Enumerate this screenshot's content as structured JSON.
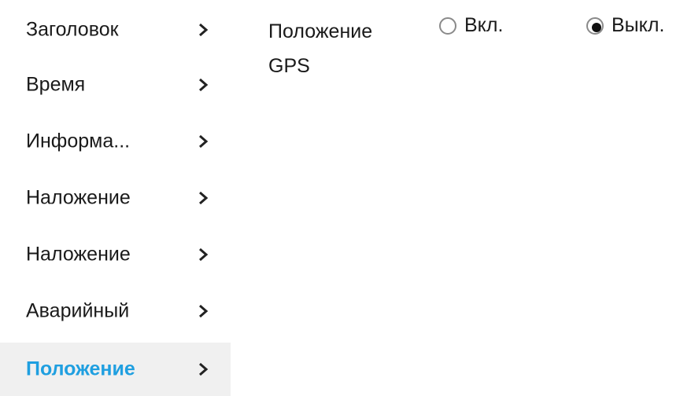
{
  "sidebar": {
    "items": [
      {
        "label": "Заголовок",
        "active": false
      },
      {
        "label": "Время",
        "active": false
      },
      {
        "label": "Информа...",
        "active": false
      },
      {
        "label": "Наложение",
        "active": false
      },
      {
        "label": "Наложение",
        "active": false
      },
      {
        "label": "Аварийный",
        "active": false
      },
      {
        "label": "Положение",
        "active": true
      }
    ],
    "chevron_icon": "chevron-right-icon"
  },
  "main": {
    "gps_position": {
      "label": "Положение GPS",
      "options": [
        {
          "label": "Вкл.",
          "selected": false
        },
        {
          "label": "Выкл.",
          "selected": true
        }
      ]
    }
  },
  "colors": {
    "active_text": "#1f9fe0",
    "active_bg": "#f0f0f0",
    "text": "#1a1a1a"
  }
}
